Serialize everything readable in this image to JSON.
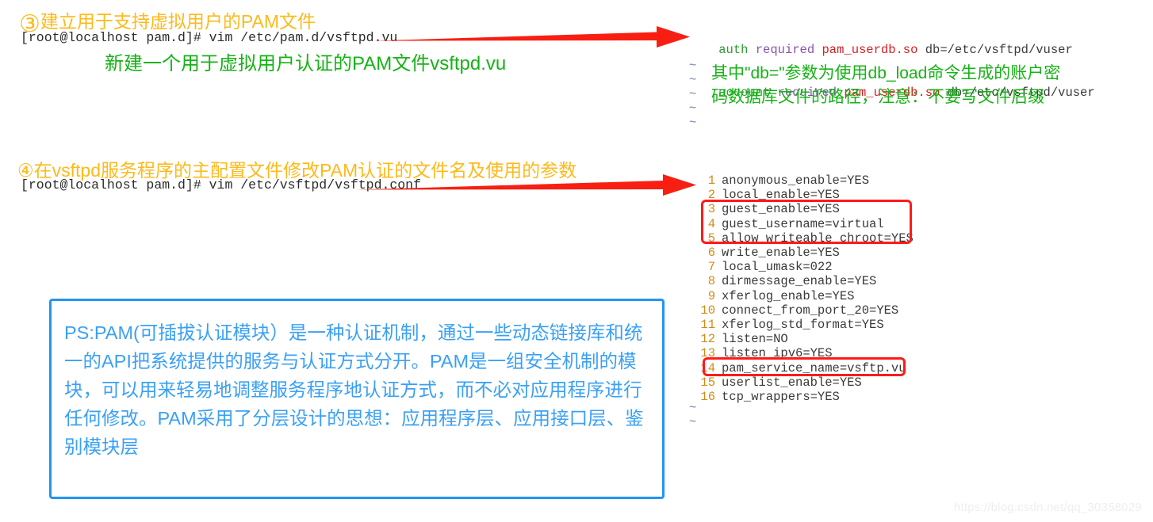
{
  "section3": {
    "number": "③",
    "heading": "建立用于支持虚拟用户的PAM文件",
    "command": "[root@localhost pam.d]# vim /etc/pam.d/vsftpd.vu",
    "annotation": "新建一个用于虚拟用户认证的PAM文件vsftpd.vu"
  },
  "section4": {
    "number": "④",
    "heading": "在vsftpd服务程序的主配置文件修改PAM认证的文件名及使用的参数",
    "command": "[root@localhost pam.d]# vim /etc/vsftpd/vsftpd.conf"
  },
  "pam_file": {
    "lines": [
      {
        "directive": "auth",
        "control": "required",
        "module": "pam_userdb.so",
        "args": "db=/etc/vsftpd/vuser"
      },
      {
        "directive": "account",
        "control": "required",
        "module": "pam_userdb.so",
        "args": "db=/etc/vsftpd/vuser"
      }
    ],
    "tilde": "~",
    "tilde_count": 5,
    "annotation_line1": "其中\"db=\"参数为使用db_load命令生成的账户密",
    "annotation_line2": "码数据库文件的路径，注意：不要写文件后缀"
  },
  "vsftpd_conf": {
    "rows": [
      {
        "num": "1",
        "text": "anonymous_enable=YES"
      },
      {
        "num": "2",
        "text": "local_enable=YES"
      },
      {
        "num": "3",
        "text": "guest_enable=YES"
      },
      {
        "num": "4",
        "text": "guest_username=virtual"
      },
      {
        "num": "5",
        "text": "allow_writeable_chroot=YES"
      },
      {
        "num": "6",
        "text": "write_enable=YES"
      },
      {
        "num": "7",
        "text": "local_umask=022"
      },
      {
        "num": "8",
        "text": "dirmessage_enable=YES"
      },
      {
        "num": "9",
        "text": "xferlog_enable=YES"
      },
      {
        "num": "10",
        "text": "connect_from_port_20=YES"
      },
      {
        "num": "11",
        "text": "xferlog_std_format=YES"
      },
      {
        "num": "12",
        "text": "listen=NO"
      },
      {
        "num": "13",
        "text": "listen_ipv6=YES"
      },
      {
        "num": "14",
        "text": "pam_service_name=vsftp.vu"
      },
      {
        "num": "15",
        "text": "userlist_enable=YES"
      },
      {
        "num": "16",
        "text": "tcp_wrappers=YES"
      }
    ],
    "tilde": "~",
    "tilde_count": 2
  },
  "ps_box": {
    "text": "PS:PAM(可插拔认证模块）是一种认证机制，通过一些动态链接库和统一的API把系统提供的服务与认证方式分开。PAM是一组安全机制的模块，可以用来轻易地调整服务程序地认证方式，而不必对应用程序进行任何修改。PAM采用了分层设计的思想：应用程序层、应用接口层、鉴别模块层"
  },
  "watermark": {
    "url": "https://blog.csdn.net/qq_30358029"
  },
  "colors": {
    "orange_heading": "#fcba1c",
    "green_note": "#16b316",
    "red_arrow": "#f81f12",
    "red_box": "#ff1a1a",
    "blue_box": "#2196f3",
    "blue_text": "#3aa0f5",
    "line_number": "#d38b16"
  }
}
